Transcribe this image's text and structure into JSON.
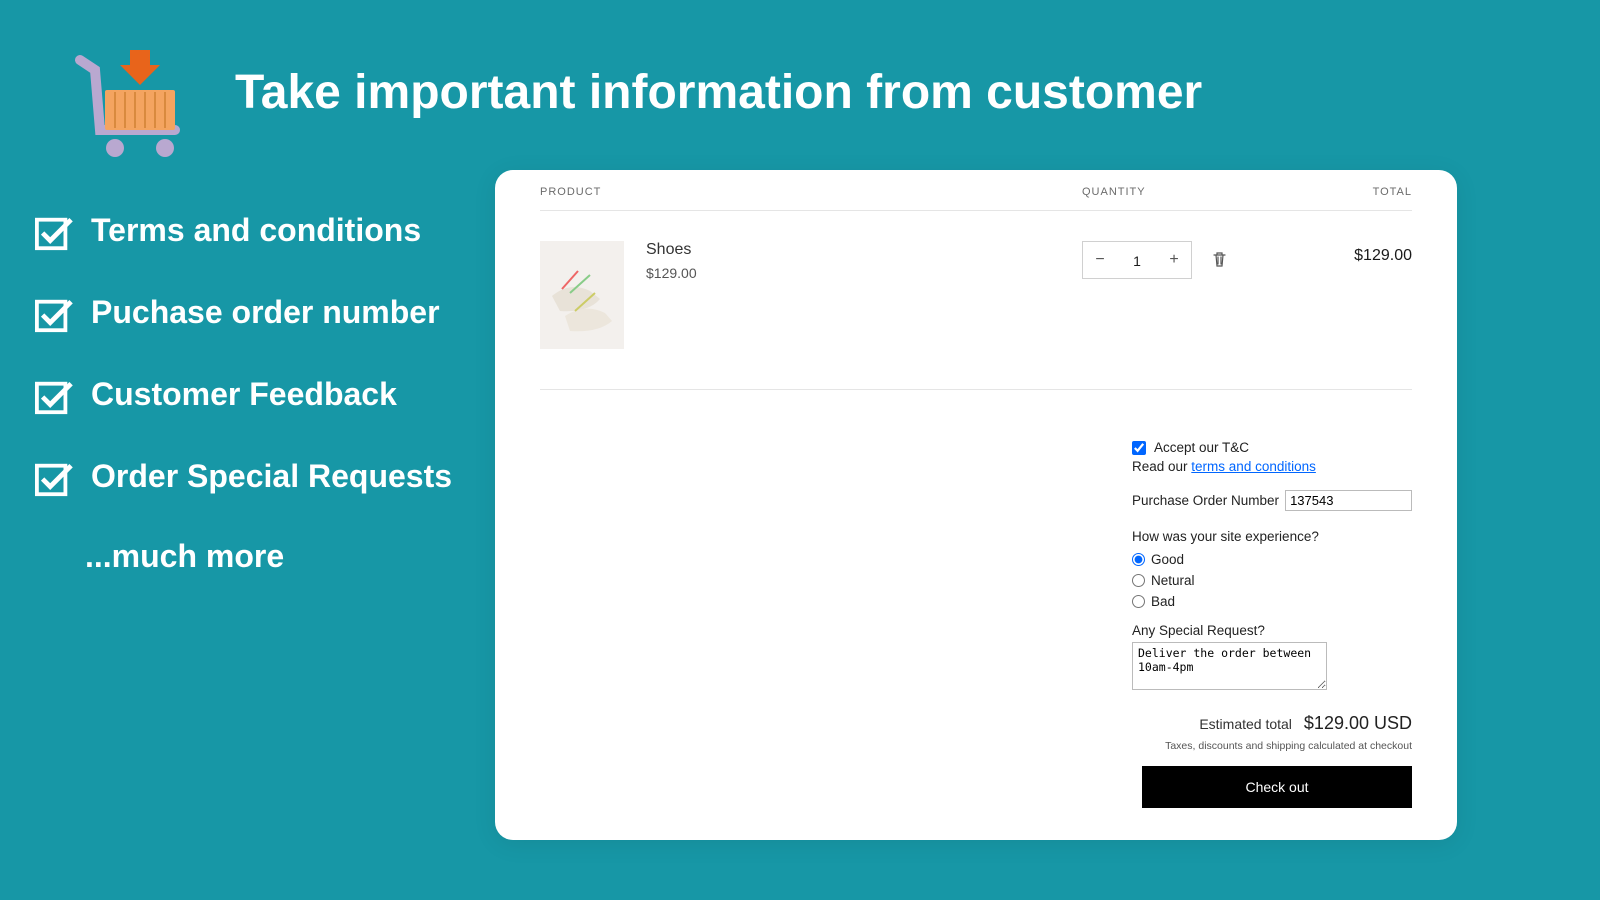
{
  "hero": {
    "title": "Take important information from customer"
  },
  "features": {
    "items": [
      "Terms and conditions",
      "Puchase order number",
      "Customer Feedback",
      "Order Special Requests"
    ],
    "more": "...much more"
  },
  "cart": {
    "headers": {
      "product": "PRODUCT",
      "quantity": "QUANTITY",
      "total": "TOTAL"
    },
    "item": {
      "name": "Shoes",
      "price": "$129.00",
      "qty": "1",
      "line_total": "$129.00"
    },
    "form": {
      "tc_label": "Accept our T&C",
      "read_prefix": "Read our ",
      "read_link": "terms and conditions",
      "po_label": "Purchase Order Number",
      "po_value": "137543",
      "exp_q": "How was your site experience?",
      "opt_good": "Good",
      "opt_neutral": "Netural",
      "opt_bad": "Bad",
      "special_q": "Any Special Request?",
      "special_value": "Deliver the order between 10am-4pm",
      "est_label": "Estimated total",
      "est_amount": "$129.00 USD",
      "tax_note": "Taxes, discounts and shipping calculated at checkout",
      "checkout": "Check out"
    }
  }
}
